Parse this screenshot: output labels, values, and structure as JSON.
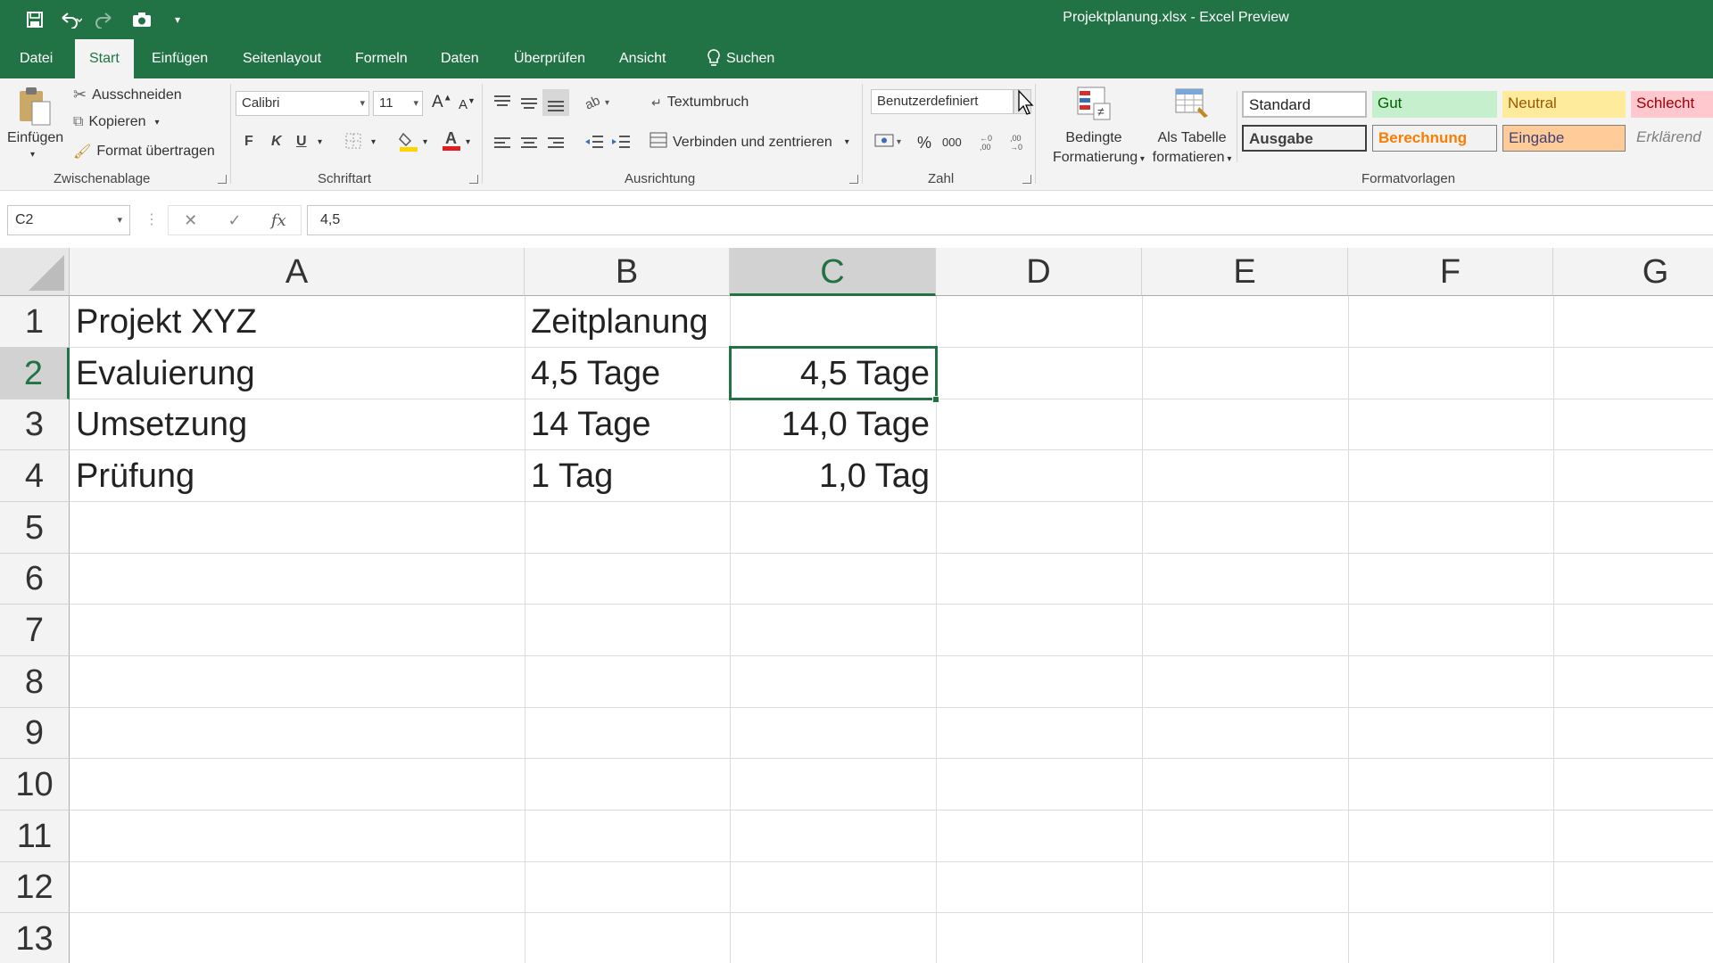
{
  "app": {
    "title": "Projektplanung.xlsx  -  Excel Preview"
  },
  "menu": {
    "tabs": [
      "Datei",
      "Start",
      "Einfügen",
      "Seitenlayout",
      "Formeln",
      "Daten",
      "Überprüfen",
      "Ansicht"
    ],
    "active_tab": "Start",
    "search_label": "Suchen"
  },
  "ribbon": {
    "clipboard": {
      "paste": "Einfügen",
      "cut": "Ausschneiden",
      "copy": "Kopieren",
      "format_painter": "Format übertragen",
      "group": "Zwischenablage"
    },
    "font": {
      "name": "Calibri",
      "size": "11",
      "bold": "F",
      "italic": "K",
      "underline": "U",
      "group": "Schriftart",
      "grow": "A",
      "shrink": "A"
    },
    "alignment": {
      "wrap": "Textumbruch",
      "merge": "Verbinden und zentrieren",
      "group": "Ausrichtung"
    },
    "number": {
      "format": "Benutzerdefiniert",
      "percent": "%",
      "thousands": "000",
      "group": "Zahl"
    },
    "styles": {
      "conditional_line1": "Bedingte",
      "conditional_line2": "Formatierung",
      "table_line1": "Als Tabelle",
      "table_line2": "formatieren",
      "group": "Formatvorlagen",
      "cells": {
        "standard": "Standard",
        "gut": "Gut",
        "neutral": "Neutral",
        "schlecht": "Schlecht",
        "ausgabe": "Ausgabe",
        "berechnung": "Berechnung",
        "eingabe": "Eingabe",
        "erklaerend": "Erklärend"
      }
    }
  },
  "formula_bar": {
    "name_box": "C2",
    "formula": "4,5"
  },
  "sheet": {
    "columns": [
      "A",
      "B",
      "C",
      "D",
      "E",
      "F",
      "G"
    ],
    "selected_column": "C",
    "rows": [
      "1",
      "2",
      "3",
      "4",
      "5",
      "6",
      "7",
      "8",
      "9",
      "10",
      "11",
      "12",
      "13"
    ],
    "selected_row": "2",
    "active_cell": "C2",
    "cells": {
      "A1": "Projekt XYZ",
      "B1": "Zeitplanung",
      "A2": "Evaluierung",
      "B2": "4,5 Tage",
      "C2": "4,5 Tage",
      "A3": "Umsetzung",
      "B3": "14 Tage",
      "C3": "14,0 Tage",
      "A4": "Prüfung",
      "B4": "1 Tag",
      "C4": "1,0 Tag"
    }
  },
  "colors": {
    "brand": "#217346",
    "style_gut_bg": "#c6efce",
    "style_neutral_bg": "#ffeb9c",
    "style_schlecht_bg": "#ffc7ce",
    "style_eingabe_bg": "#ffcc99"
  }
}
